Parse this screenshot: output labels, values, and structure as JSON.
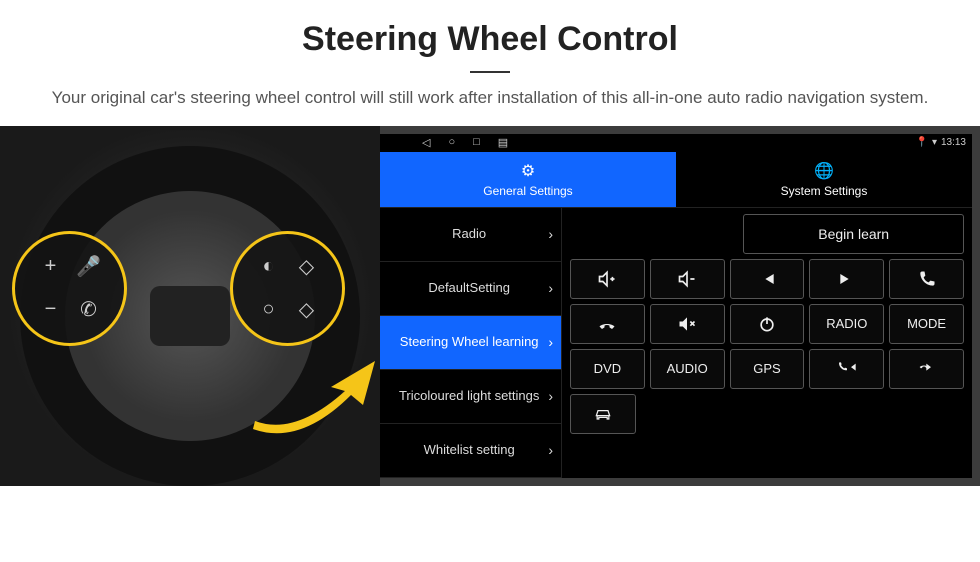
{
  "header": {
    "title": "Steering Wheel Control",
    "subtitle": "Your original car's steering wheel control will still work after installation of this all-in-one auto radio navigation system."
  },
  "statusbar": {
    "time": "13:13"
  },
  "tabs": {
    "general": "General Settings",
    "system": "System Settings"
  },
  "menu": {
    "radio": "Radio",
    "default": "DefaultSetting",
    "swl": "Steering Wheel learning",
    "tricolor": "Tricoloured light settings",
    "whitelist": "Whitelist setting"
  },
  "actions": {
    "begin": "Begin learn",
    "radio": "RADIO",
    "mode": "MODE",
    "dvd": "DVD",
    "audio": "AUDIO",
    "gps": "GPS"
  }
}
